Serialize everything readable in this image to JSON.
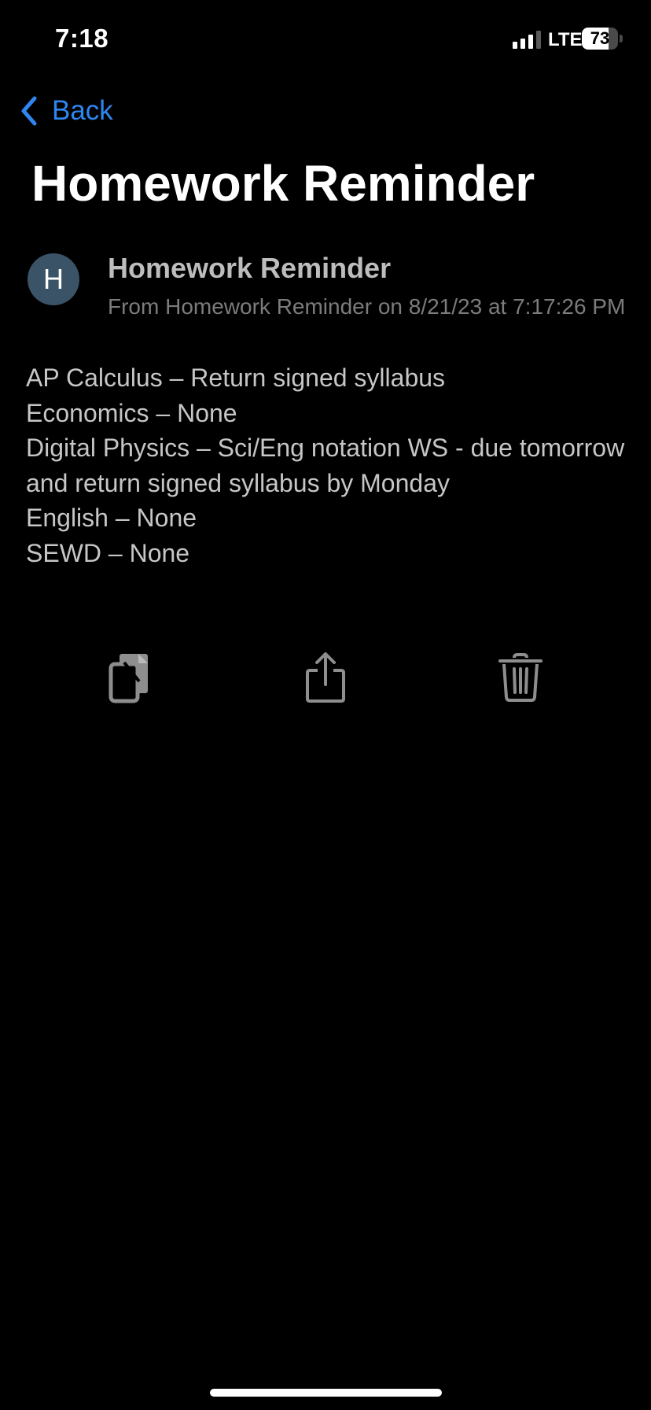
{
  "status_bar": {
    "time": "7:18",
    "network": "LTE",
    "battery": "73",
    "battery_level": 0.73
  },
  "nav": {
    "back_label": "Back"
  },
  "page": {
    "title": "Homework Reminder"
  },
  "message": {
    "avatar_initial": "H",
    "sender": "Homework Reminder",
    "meta": "From Homework Reminder on 8/21/23 at 7:17:26 PM",
    "lines": [
      "AP Calculus – Return signed syllabus",
      "Economics – None",
      "Digital Physics – Sci/Eng notation WS - due tomorrow and return signed syllabus by Monday",
      "English – None",
      "SEWD – None"
    ]
  },
  "actions": {
    "icons": [
      "copy-icon",
      "share-icon",
      "trash-icon"
    ]
  },
  "colors": {
    "background": "#000000",
    "accent": "#2f86ef",
    "avatar": "#3b5367",
    "body_text": "#c6c6c6",
    "meta_text": "#7c7c7c",
    "icon": "#8e8e8e"
  }
}
